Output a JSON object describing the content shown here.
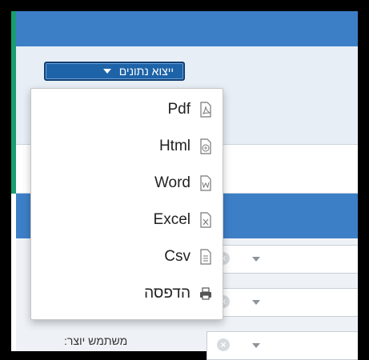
{
  "export_button": {
    "label": "ייצוא נתונים"
  },
  "export_menu": {
    "items": [
      {
        "label": "Pdf",
        "icon": "pdf-file-icon"
      },
      {
        "label": "Html",
        "icon": "html-file-icon"
      },
      {
        "label": "Word",
        "icon": "word-file-icon"
      },
      {
        "label": "Excel",
        "icon": "excel-file-icon"
      },
      {
        "label": "Csv",
        "icon": "csv-file-icon"
      },
      {
        "label": "הדפסה",
        "icon": "printer-icon"
      }
    ]
  },
  "form": {
    "user_label": "משתמש יוצר:"
  },
  "colors": {
    "header_blue": "#3d7fc7",
    "button_blue": "#1d63a8",
    "accent_green": "#1a9e6f"
  }
}
